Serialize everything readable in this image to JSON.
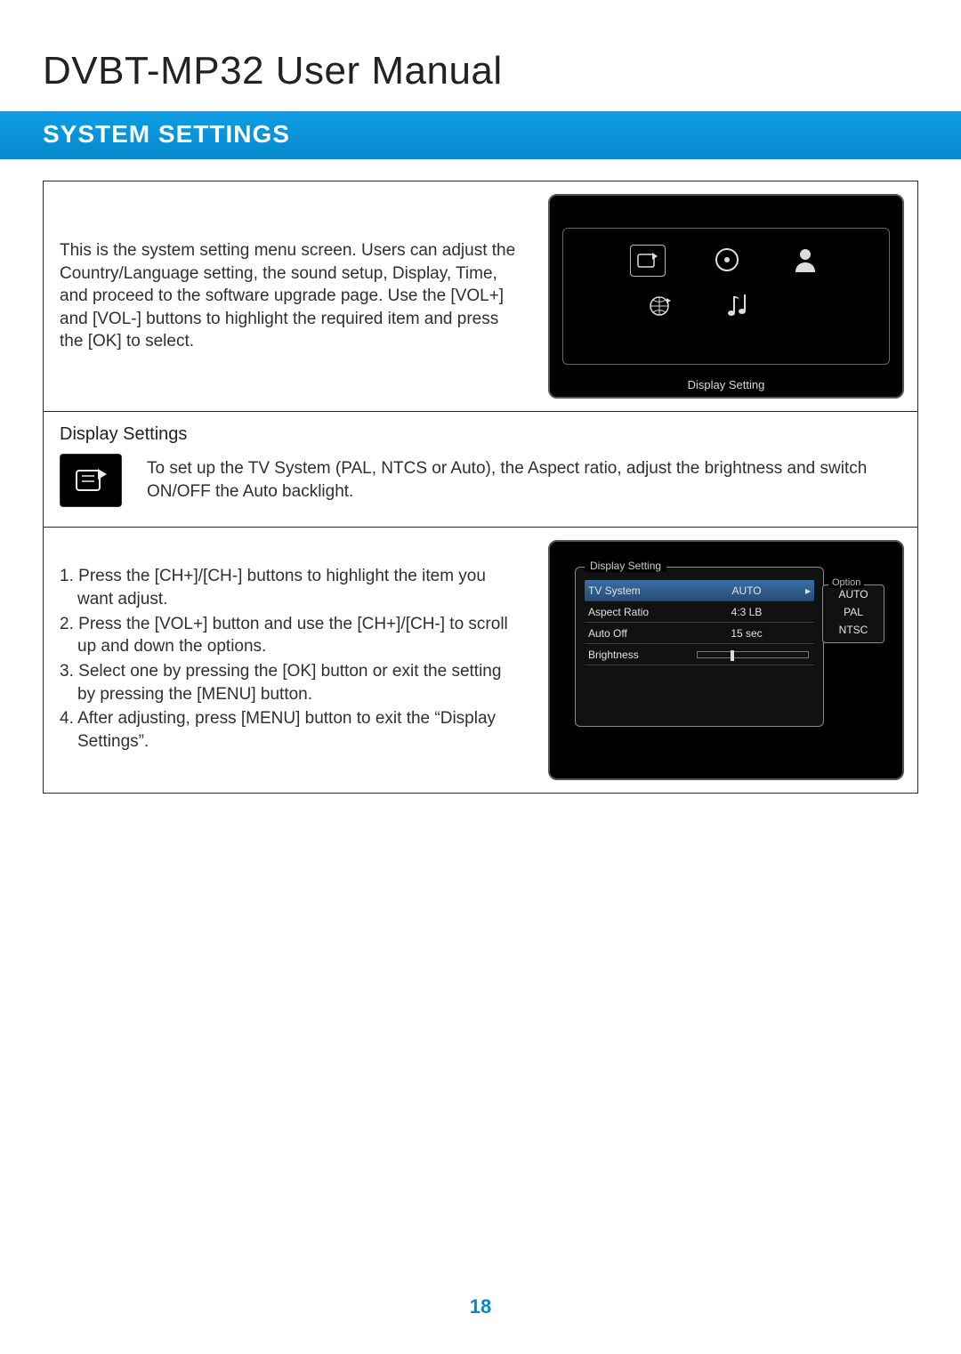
{
  "header": {
    "title": "DVBT-MP32 User Manual",
    "section": "SYSTEM SETTINGS"
  },
  "intro": {
    "text": "This is the system setting menu screen. Users can adjust the Country/Language setting, the sound setup, Display, Time, and proceed to the software upgrade page. Use the [VOL+] and [VOL-] buttons to highlight the required item and press the [OK] to select."
  },
  "screen1": {
    "caption": "Display Setting"
  },
  "display": {
    "title": "Display Settings",
    "desc": "To set up the TV System (PAL, NTCS or Auto), the Aspect ratio, adjust the brightness and switch ON/OFF the Auto backlight."
  },
  "steps": [
    "Press the [CH+]/[CH-] buttons to highlight the item you want adjust.",
    "Press the [VOL+] button and use the  [CH+]/[CH-] to scroll up and down the options.",
    "Select one by pressing the [OK] button or exit the setting by pressing the [MENU] button.",
    "After adjusting, press [MENU] button to exit the “Display Settings”."
  ],
  "screen2": {
    "title": "Display Setting",
    "items": [
      {
        "label": "TV System",
        "value": "AUTO",
        "selected": true,
        "arrow": "▸"
      },
      {
        "label": "Aspect Ratio",
        "value": "4:3 LB"
      },
      {
        "label": "Auto Off",
        "value": "15 sec"
      },
      {
        "label": "Brightness",
        "slider": true
      }
    ],
    "options": {
      "title": "Option",
      "list": [
        "AUTO",
        "PAL",
        "NTSC"
      ]
    }
  },
  "pageNumber": "18"
}
